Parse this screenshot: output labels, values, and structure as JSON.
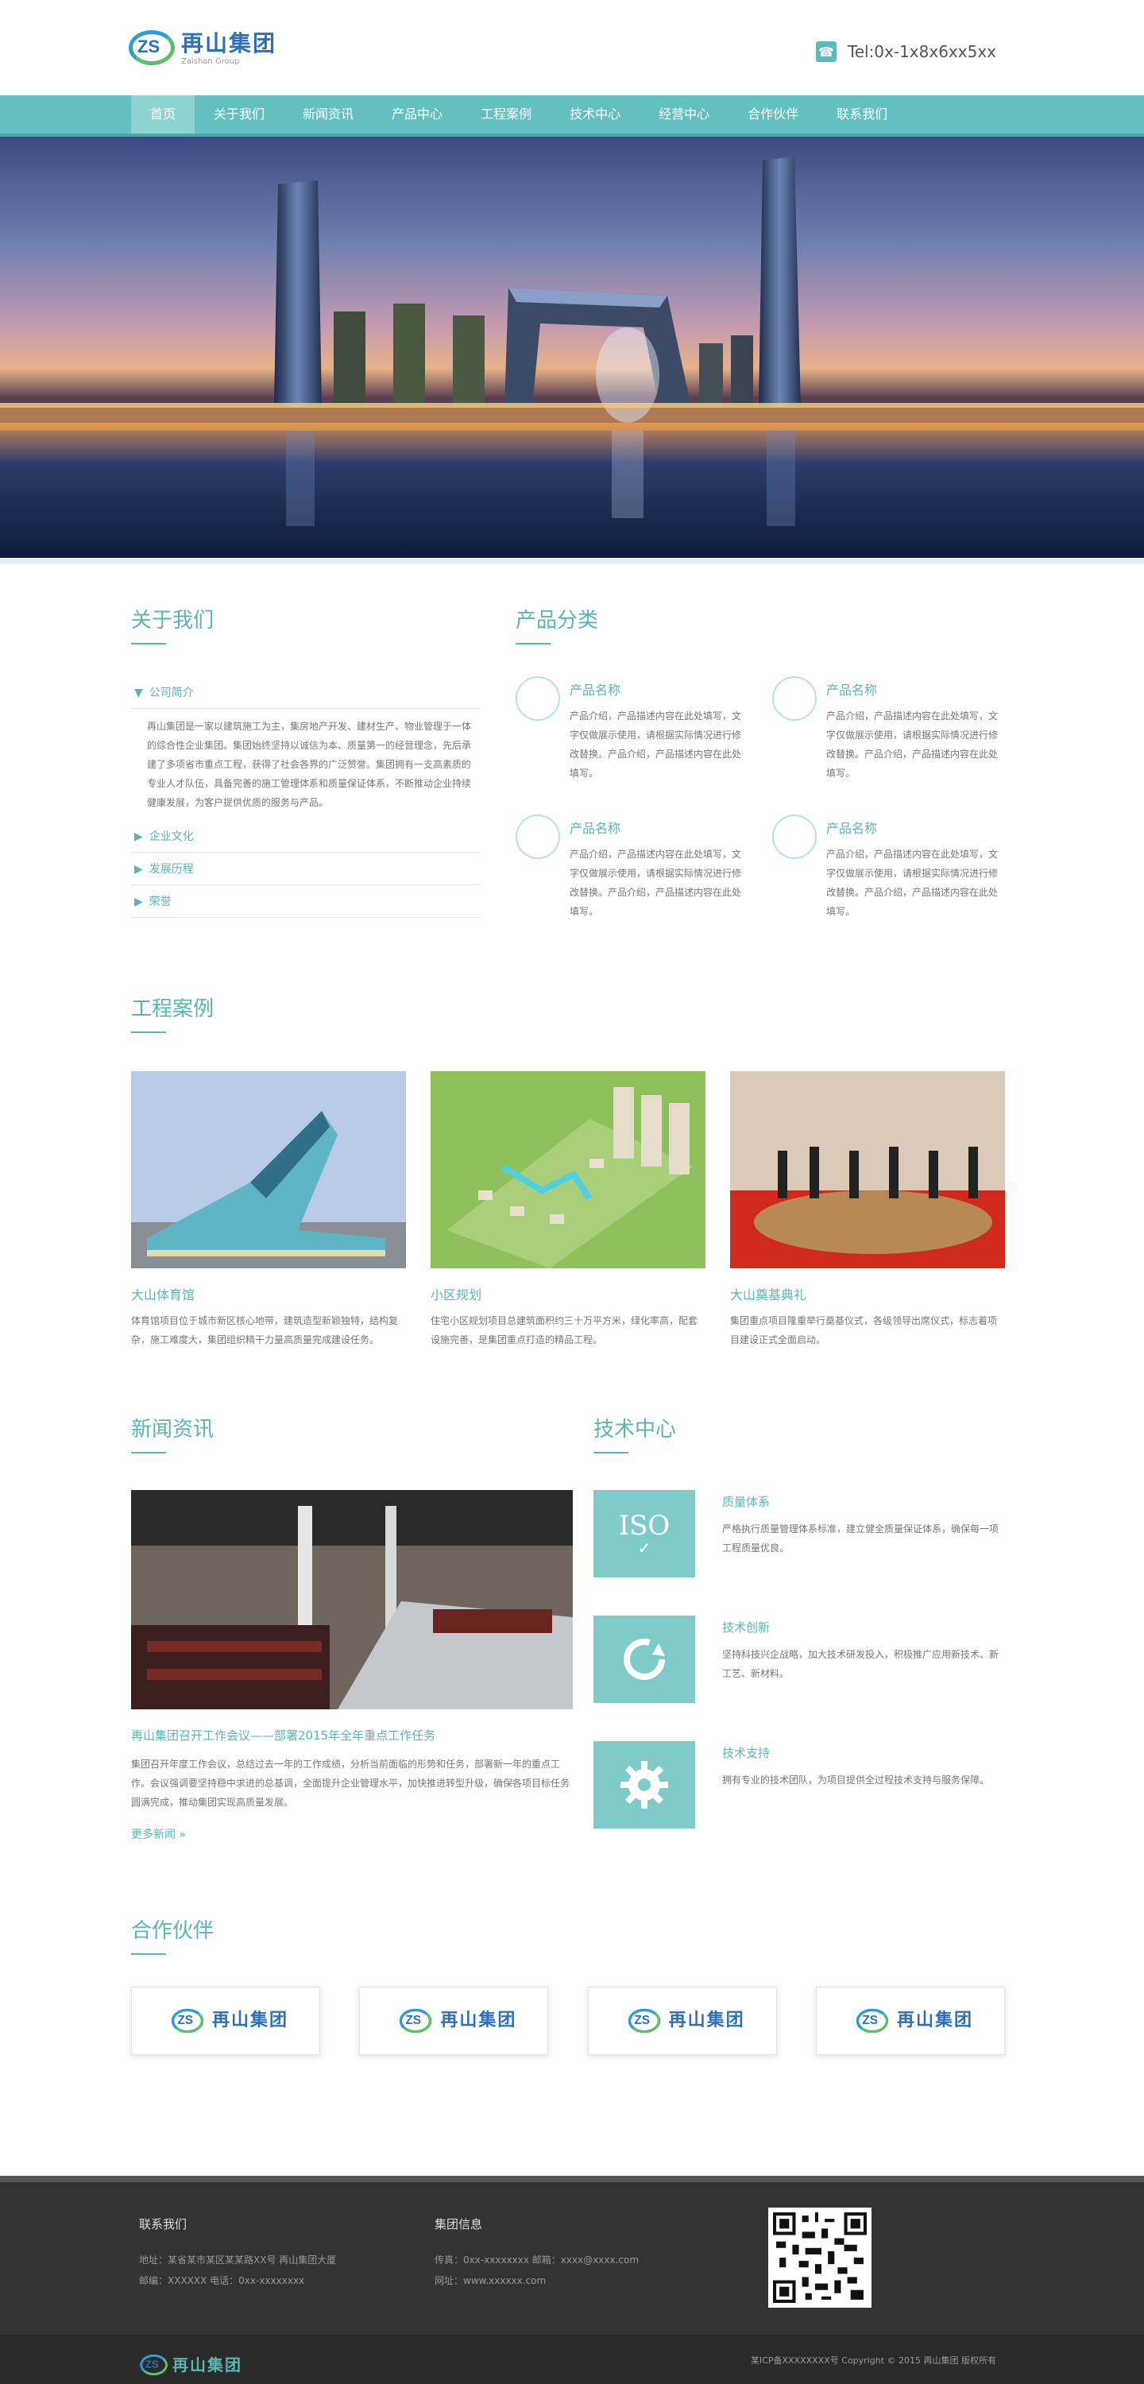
{
  "header": {
    "logo_cn": "再山集团",
    "logo_en": "Zaishan Group",
    "logo_letters": "ZS",
    "tel": "Tel:0x-1x8x6xx5xx"
  },
  "nav": [
    "首页",
    "关于我们",
    "新闻资讯",
    "产品中心",
    "工程案例",
    "技术中心",
    "经营中心",
    "合作伙伴",
    "联系我们"
  ],
  "about": {
    "title": "关于我们",
    "items": [
      {
        "label": "公司简介",
        "body": "再山集团是一家以建筑施工为主，集房地产开发、建材生产、物业管理于一体的综合性企业集团。集团始终坚持以诚信为本、质量第一的经营理念，先后承建了多项省市重点工程，获得了社会各界的广泛赞誉。集团拥有一支高素质的专业人才队伍，具备完善的施工管理体系和质量保证体系，不断推动企业持续健康发展，为客户提供优质的服务与产品。"
      },
      {
        "label": "企业文化"
      },
      {
        "label": "发展历程"
      },
      {
        "label": "荣誉"
      }
    ]
  },
  "products": {
    "title": "产品分类",
    "items": [
      {
        "name": "产品名称",
        "desc": "产品介绍，产品描述内容在此处填写，文字仅做展示使用，请根据实际情况进行修改替换。产品介绍，产品描述内容在此处填写。"
      },
      {
        "name": "产品名称",
        "desc": "产品介绍，产品描述内容在此处填写，文字仅做展示使用，请根据实际情况进行修改替换。产品介绍，产品描述内容在此处填写。"
      },
      {
        "name": "产品名称",
        "desc": "产品介绍，产品描述内容在此处填写，文字仅做展示使用，请根据实际情况进行修改替换。产品介绍，产品描述内容在此处填写。"
      },
      {
        "name": "产品名称",
        "desc": "产品介绍，产品描述内容在此处填写，文字仅做展示使用，请根据实际情况进行修改替换。产品介绍，产品描述内容在此处填写。"
      }
    ]
  },
  "cases": {
    "title": "工程案例",
    "items": [
      {
        "name": "大山体育馆",
        "desc": "体育馆项目位于城市新区核心地带，建筑造型新颖独特，结构复杂，施工难度大，集团组织精干力量高质量完成建设任务。"
      },
      {
        "name": "小区规划",
        "desc": "住宅小区规划项目总建筑面积约三十万平方米，绿化率高，配套设施完善，是集团重点打造的精品工程。"
      },
      {
        "name": "大山奠基典礼",
        "desc": "集团重点项目隆重举行奠基仪式，各级领导出席仪式，标志着项目建设正式全面启动。"
      }
    ]
  },
  "news": {
    "title": "新闻资讯",
    "headline": "再山集团召开工作会议——部署2015年全年重点工作任务",
    "desc": "集团召开年度工作会议，总结过去一年的工作成绩，分析当前面临的形势和任务，部署新一年的重点工作。会议强调要坚持稳中求进的总基调，全面提升企业管理水平，加快推进转型升级，确保各项目标任务圆满完成，推动集团实现高质量发展。",
    "more": "更多新闻 »"
  },
  "tech": {
    "title": "技术中心",
    "items": [
      {
        "icon": "iso-badge-icon",
        "icon_text": "ISO",
        "name": "质量体系",
        "desc": "严格执行质量管理体系标准，建立健全质量保证体系，确保每一项工程质量优良。"
      },
      {
        "icon": "refresh-icon",
        "name": "技术创新",
        "desc": "坚持科技兴企战略，加大技术研发投入，积极推广应用新技术、新工艺、新材料。"
      },
      {
        "icon": "gear-icon",
        "name": "技术支持",
        "desc": "拥有专业的技术团队，为项目提供全过程技术支持与服务保障。"
      }
    ]
  },
  "partners": {
    "title": "合作伙伴",
    "count_label": "再山集团"
  },
  "footer": {
    "contact_title": "联系我们",
    "contact_lines": [
      "地址：某省某市某区某某路XX号 再山集团大厦",
      "邮编：XXXXXX 电话：0xx-xxxxxxxx"
    ],
    "info_title": "集团信息",
    "info_lines": [
      "传真：0xx-xxxxxxxx 邮箱：xxxx@xxxx.com",
      "网址：www.xxxxxx.com"
    ],
    "copyright": "某ICP备XXXXXXXX号    Copyright © 2015 再山集团 版权所有"
  },
  "colors": {
    "accent": "#5ab5b3",
    "nav_bg": "#63c0be",
    "footer_bg": "#333333"
  }
}
